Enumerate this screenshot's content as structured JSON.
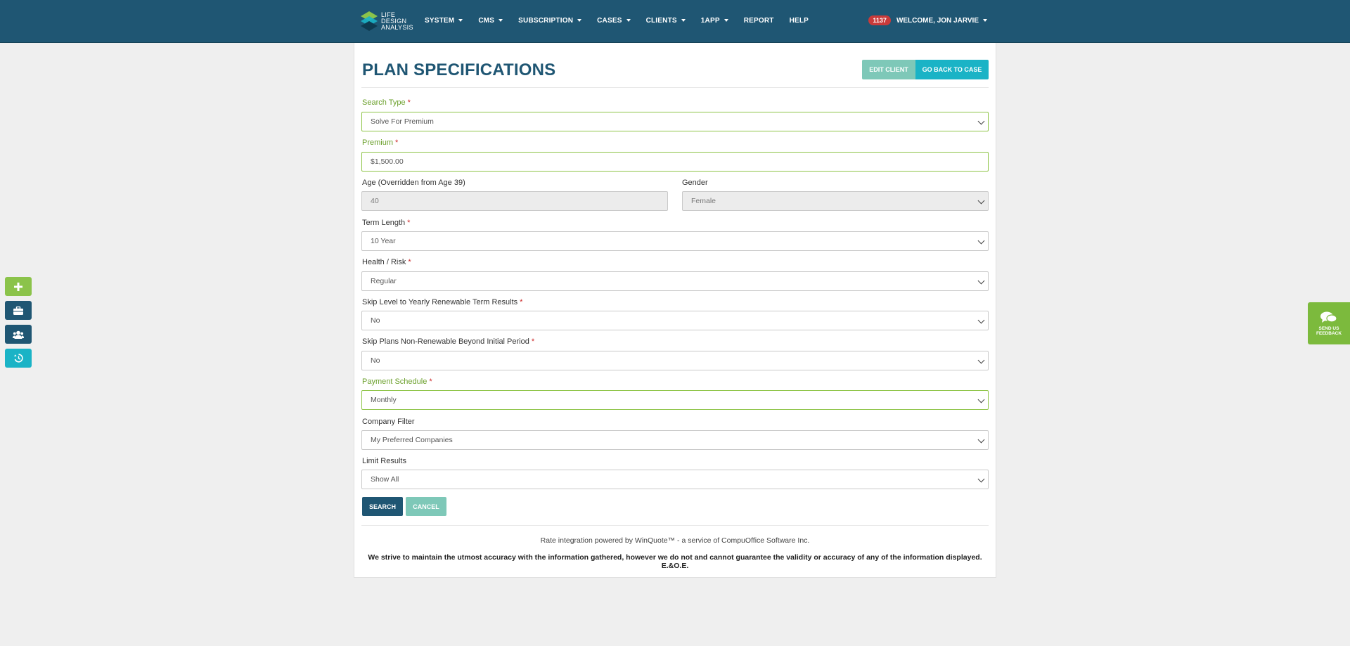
{
  "brand": {
    "line1": "LIFE",
    "line2": "DESIGN",
    "line3": "ANALYSIS"
  },
  "nav": {
    "items": [
      {
        "label": "SYSTEM",
        "dropdown": true
      },
      {
        "label": "CMS",
        "dropdown": true
      },
      {
        "label": "SUBSCRIPTION",
        "dropdown": true
      },
      {
        "label": "CASES",
        "dropdown": true
      },
      {
        "label": "CLIENTS",
        "dropdown": true
      },
      {
        "label": "1APP",
        "dropdown": true
      },
      {
        "label": "REPORT",
        "dropdown": false
      },
      {
        "label": "HELP",
        "dropdown": false
      }
    ],
    "notification_count": "1137",
    "welcome": "WELCOME, JON JARVIE"
  },
  "page": {
    "title": "PLAN SPECIFICATIONS",
    "edit_client": "EDIT CLIENT",
    "go_back": "GO BACK TO CASE"
  },
  "form": {
    "search_type": {
      "label": "Search Type",
      "value": "Solve For Premium"
    },
    "premium": {
      "label": "Premium",
      "value": "$1,500.00"
    },
    "age": {
      "label": "Age (Overridden from Age 39)",
      "value": "40"
    },
    "gender": {
      "label": "Gender",
      "value": "Female"
    },
    "term_length": {
      "label": "Term Length",
      "value": "10 Year"
    },
    "health_risk": {
      "label": "Health / Risk",
      "value": "Regular"
    },
    "skip_level": {
      "label": "Skip Level to Yearly Renewable Term Results",
      "value": "No"
    },
    "skip_plans": {
      "label": "Skip Plans Non-Renewable Beyond Initial Period",
      "value": "No"
    },
    "payment_schedule": {
      "label": "Payment Schedule",
      "value": "Monthly"
    },
    "company_filter": {
      "label": "Company Filter",
      "value": "My Preferred Companies"
    },
    "limit_results": {
      "label": "Limit Results",
      "value": "Show All"
    },
    "required_mark": "*",
    "search_btn": "SEARCH",
    "cancel_btn": "CANCEL"
  },
  "footer": {
    "powered_by": "Rate integration powered by WinQuote™ - a service of CompuOffice Software Inc.",
    "disclaimer": "We strive to maintain the utmost accuracy with the information gathered, however we do not and cannot guarantee the validity or accuracy of any of the information displayed. E.&O.E."
  },
  "feedback": {
    "line1": "SEND US",
    "line2": "FEEDBACK"
  },
  "colors": {
    "nav_bg": "#1f5673",
    "accent_green": "#8bc34a",
    "accent_teal": "#1ab3c6",
    "muted_teal": "#7ec8b8",
    "badge_red": "#c93a3a"
  },
  "icons": {
    "quick_add": "plus-icon",
    "quick_cases": "briefcase-icon",
    "quick_clients": "users-icon",
    "quick_history": "history-icon",
    "feedback": "chat-bubbles-icon"
  }
}
